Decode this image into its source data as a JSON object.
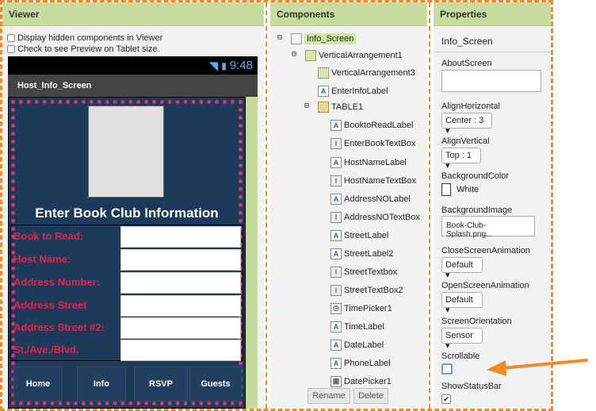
{
  "viewer": {
    "header": "Viewer",
    "checkbox_hidden": "Display hidden components in Viewer",
    "checkbox_tablet": "Check to see Preview on Tablet size.",
    "status_time": "9:48",
    "title_bar": "Host_Info_Screen",
    "screen_title": "Enter Book Club Information",
    "rows": [
      "Book to Read:",
      "Host Name:",
      "Address Number:",
      "Address Street",
      "Address Street #2:",
      "St./Ave./Blvd."
    ],
    "buttons": [
      "Home",
      "Info",
      "RSVP",
      "Guests"
    ]
  },
  "components": {
    "header": "Components",
    "tree": [
      "Info_Screen",
      "VerticalArrangement1",
      "VerticalArrangement3",
      "EnterInfoLabel",
      "TABLE1",
      "BooktoReadLabel",
      "EnterBookTextBox",
      "HostNameLabel",
      "HostNameTextBox",
      "AddressNOLabel",
      "AddressNOTextBox",
      "StreetLabel",
      "StreetLabel2",
      "StreetTextbox",
      "StreetTextBox2",
      "TimePicker1",
      "TimeLabel",
      "DateLabel",
      "PhoneLabel",
      "DatePicker1"
    ],
    "rename": "Rename",
    "delete": "Delete"
  },
  "properties": {
    "header": "Properties",
    "component": "Info_Screen",
    "about_label": "AboutScreen",
    "align_h_label": "AlignHorizontal",
    "align_h_value": "Center : 3 ▾",
    "align_v_label": "AlignVertical",
    "align_v_value": "Top : 1 ▾",
    "bg_color_label": "BackgroundColor",
    "bg_color_value": "White",
    "bg_image_label": "BackgroundImage",
    "bg_image_value": "Book-Club-Splash.png...",
    "close_anim_label": "CloseScreenAnimation",
    "close_anim_value": "Default ▾",
    "open_anim_label": "OpenScreenAnimation",
    "open_anim_value": "Default ▾",
    "orientation_label": "ScreenOrientation",
    "orientation_value": "Sensor ▾",
    "scrollable_label": "Scrollable",
    "statusbar_label": "ShowStatusBar"
  },
  "colors": {
    "accent": "#f08a24",
    "header": "#c9dca0",
    "screen_bg": "#1e3a5a",
    "label_red": "#e8204e",
    "dot_border": "#d9366e"
  }
}
